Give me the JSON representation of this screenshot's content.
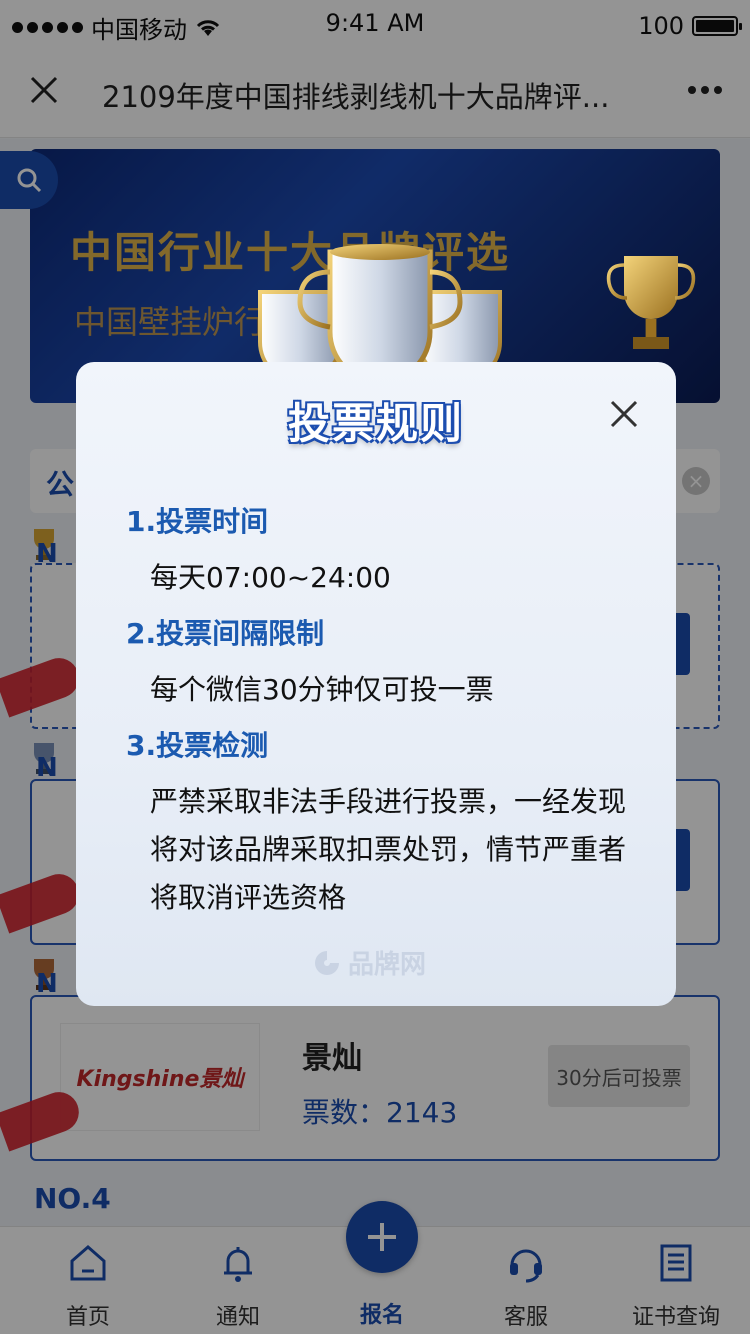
{
  "status_bar": {
    "carrier": "中国移动",
    "time": "9:41 AM",
    "battery": "100"
  },
  "nav": {
    "title": "2109年度中国排线剥线机十大品牌评..."
  },
  "banner": {
    "title": "中国行业十大品牌评选",
    "subtitle": "中国壁挂炉行业"
  },
  "notice": {
    "label": "公"
  },
  "ranks": [
    {
      "no": "N",
      "brand": "",
      "votes": ""
    },
    {
      "no": "N",
      "brand": "",
      "votes": ""
    },
    {
      "no": "N",
      "brand": "景灿",
      "votes": "票数：2143",
      "logo": "Kingshine景灿",
      "button": "30分后可投票"
    }
  ],
  "rank4": {
    "no": "NO.4"
  },
  "tabbar": {
    "items": [
      {
        "label": "首页",
        "icon": "home-icon"
      },
      {
        "label": "通知",
        "icon": "bell-icon"
      },
      {
        "label": "报名",
        "icon": "plus-icon"
      },
      {
        "label": "客服",
        "icon": "headset-icon"
      },
      {
        "label": "证书查询",
        "icon": "document-icon"
      }
    ]
  },
  "modal": {
    "title": "投票规则",
    "rules": [
      {
        "heading": "1.投票时间",
        "body": "每天07:00~24:00"
      },
      {
        "heading": "2.投票间隔限制",
        "body": "每个微信30分钟仅可投一票"
      },
      {
        "heading": "3.投票检测",
        "body": "严禁采取非法手段进行投票，一经发现 将对该品牌采取扣票处罚，情节严重者 将取消评选资格"
      }
    ],
    "watermark": "品牌网"
  },
  "colors": {
    "accent": "#1b4cae",
    "heading": "#1b5ab0",
    "gold": "#e2b54a",
    "ribbon": "#d0202a"
  }
}
